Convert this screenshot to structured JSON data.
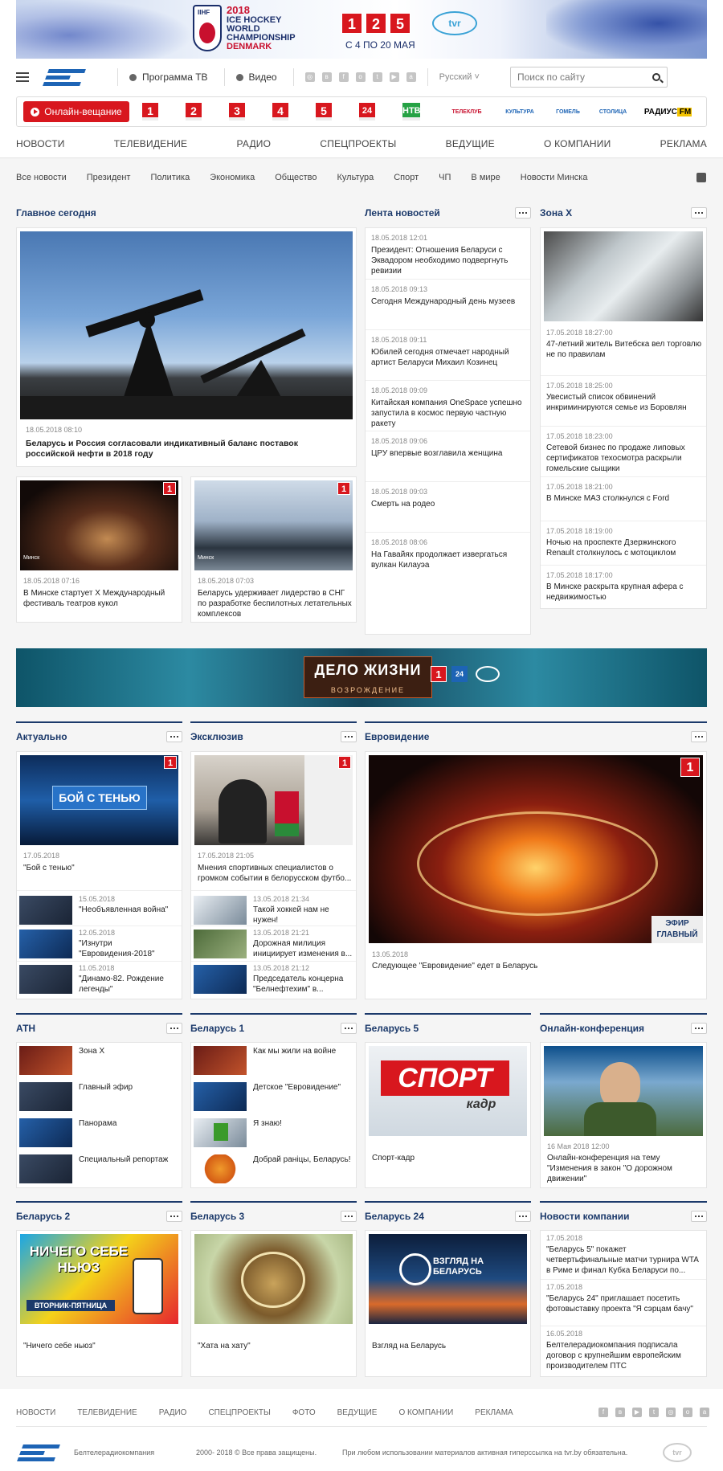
{
  "banner_top": {
    "year": "2018",
    "title_lines": [
      "ICE HOCKEY",
      "WORLD",
      "CHAMPIONSHIP"
    ],
    "country": "DENMARK",
    "brand": "IIHF",
    "channels": [
      "1",
      "2",
      "5"
    ],
    "tvr": "tvr",
    "dates": "С 4 ПО 20 МАЯ"
  },
  "header": {
    "program_label": "Программа ТВ",
    "video_label": "Видео",
    "language": "Русский",
    "search_placeholder": "Поиск по сайту",
    "socials": [
      "instagram-icon",
      "vk-icon",
      "facebook-icon",
      "ok-icon",
      "twitter-icon",
      "youtube-icon",
      "android-icon"
    ]
  },
  "channel_bar": {
    "online_label": "Онлайн-вещание",
    "channels": [
      "1",
      "2",
      "3",
      "4",
      "5",
      "24",
      "НТВ"
    ],
    "logos": [
      "ТЕЛЕКЛУБ",
      "КУЛЬТУРА",
      "ГОМЕЛЬ",
      "СТОЛИЦА",
      "РАДИУС FM"
    ]
  },
  "main_nav": [
    "НОВОСТИ",
    "ТЕЛЕВИДЕНИЕ",
    "РАДИО",
    "СПЕЦПРОЕКТЫ",
    "ВЕДУЩИЕ",
    "О КОМПАНИИ",
    "РЕКЛАМА"
  ],
  "sub_nav": [
    "Все новости",
    "Президент",
    "Политика",
    "Экономика",
    "Общество",
    "Культура",
    "Спорт",
    "ЧП",
    "В мире",
    "Новости Минска"
  ],
  "main_today": {
    "title": "Главное сегодня",
    "lead": {
      "date": "18.05.2018 08:10",
      "text": "Беларусь и Россия согласовали индикативный баланс поставок российской нефти в 2018 году"
    },
    "items": [
      {
        "date": "18.05.2018 07:16",
        "text": "В Минске стартует X Международный фестиваль театров кукол",
        "tag": "Минск"
      },
      {
        "date": "18.05.2018 07:03",
        "text": "Беларусь удерживает лидерство в СНГ по разработке беспилотных летательных комплексов",
        "tag": "Минск"
      }
    ]
  },
  "news_feed": {
    "title": "Лента новостей",
    "items": [
      {
        "date": "18.05.2018 12:01",
        "text": "Президент: Отношения Беларуси с Эквадором необходимо подвергнуть ревизии"
      },
      {
        "date": "18.05.2018 09:13",
        "text": "Сегодня Международный день музеев"
      },
      {
        "date": "18.05.2018 09:11",
        "text": "Юбилей сегодня отмечает народный артист Беларуси Михаил Козинец"
      },
      {
        "date": "18.05.2018 09:09",
        "text": "Китайская компания OneSpace успешно запустила в космос первую частную ракету"
      },
      {
        "date": "18.05.2018 09:06",
        "text": "ЦРУ впервые возглавила женщина"
      },
      {
        "date": "18.05.2018 09:03",
        "text": "Смерть на родео"
      },
      {
        "date": "18.05.2018 08:06",
        "text": "На Гавайях продолжает извергаться вулкан Килауэа"
      }
    ]
  },
  "zona_x": {
    "title": "Зона Х",
    "items": [
      {
        "date": "17.05.2018 18:27:00",
        "text": "47-летний житель Витебска вел торговлю не по правилам"
      },
      {
        "date": "17.05.2018 18:25:00",
        "text": "Увесистый список обвинений инкриминируются семье из Боровлян"
      },
      {
        "date": "17.05.2018 18:23:00",
        "text": "Сетевой бизнес по продаже липовых сертификатов техосмотра раскрыли гомельские сыщики"
      },
      {
        "date": "17.05.2018 18:21:00",
        "text": "В Минске МАЗ столкнулся с Ford"
      },
      {
        "date": "17.05.2018 18:19:00",
        "text": "Ночью на проспекте Дзержинского Renault столкнулось с мотоциклом"
      },
      {
        "date": "17.05.2018 18:17:00",
        "text": "В Минске раскрыта крупная афера с недвижимостью"
      }
    ]
  },
  "mid_banner": {
    "title": "ДЕЛО ЖИЗНИ",
    "subtitle": "ВОЗРОЖДЕНИЕ"
  },
  "aktualno": {
    "title": "Актуально",
    "lead_overlay": "БОЙ С ТЕНЬЮ",
    "lead": {
      "date": "17.05.2018",
      "text": "\"Бой с тенью\""
    },
    "items": [
      {
        "date": "15.05.2018",
        "text": "\"Необъявленная война\""
      },
      {
        "date": "12.05.2018",
        "text": "\"Изнутри \"Евровидения-2018\""
      },
      {
        "date": "11.05.2018",
        "text": "\"Динамо-82. Рождение легенды\""
      }
    ]
  },
  "exclusive": {
    "title": "Эксклюзив",
    "lead": {
      "date": "17.05.2018 21:05",
      "text": "Мнения спортивных специалистов о громком событии в белорусском футбо..."
    },
    "items": [
      {
        "date": "13.05.2018 21:34",
        "text": "Такой хоккей нам не нужен!"
      },
      {
        "date": "13.05.2018 21:21",
        "text": "Дорожная милиция инициирует изменения в..."
      },
      {
        "date": "13.05.2018 21:12",
        "text": "Председатель концерна \"Белнефтехим\" в..."
      }
    ]
  },
  "eurovision": {
    "title": "Евровидение",
    "overlay": "ЭФИР ГЛАВНЫЙ",
    "date": "13.05.2018",
    "text": "Следующее \"Евровидение\" едет в Беларусь"
  },
  "atn": {
    "title": "АТН",
    "items": [
      "Зона Х",
      "Главный эфир",
      "Панорама",
      "Специальный репортаж"
    ]
  },
  "belarus1": {
    "title": "Беларусь 1",
    "items": [
      "Как мы жили на войне",
      "Детское \"Евровидение\"",
      "Я знаю!",
      "Добрай раніцы, Беларусь!"
    ]
  },
  "belarus5": {
    "title": "Беларусь 5",
    "overlay": "СПОРТ",
    "overlay_sub": "кадр",
    "text": "Спорт-кадр"
  },
  "online_conf": {
    "title": "Онлайн-конференция",
    "date": "16 Мая 2018 12:00",
    "text": "Онлайн-конференция на тему \"Изменения в закон \"О дорожном движении\""
  },
  "belarus2": {
    "title": "Беларусь 2",
    "overlay": "НИЧЕГО СЕБЕ НЬЮЗ",
    "overlay_sub": "ВТОРНИК-ПЯТНИЦА",
    "text": "\"Ничего себе ньюз\""
  },
  "belarus3": {
    "title": "Беларусь 3",
    "text": "\"Хата на хату\""
  },
  "belarus24": {
    "title": "Беларусь 24",
    "overlay": "ВЗГЛЯД НА БЕЛАРУСЬ",
    "text": "Взгляд на Беларусь"
  },
  "company_news": {
    "title": "Новости компании",
    "items": [
      {
        "date": "17.05.2018",
        "text": "\"Беларусь 5\" покажет четвертьфинальные матчи турнира WTA в Риме и финал Кубка Беларуси по..."
      },
      {
        "date": "17.05.2018",
        "text": "\"Беларусь 24\" приглашает посетить фотовыставку проекта \"Я сэрцам бачу\""
      },
      {
        "date": "16.05.2018",
        "text": "Белтелерадиокомпания подписала договор с крупнейшим европейским производителем ПТС"
      }
    ]
  },
  "footer": {
    "nav": [
      "НОВОСТИ",
      "ТЕЛЕВИДЕНИЕ",
      "РАДИО",
      "СПЕЦПРОЕКТЫ",
      "ФОТО",
      "ВЕДУЩИЕ",
      "О КОМПАНИИ",
      "РЕКЛАМА"
    ],
    "company": "Белтелерадиокомпания",
    "copyright": "2000- 2018 © Все права защищены.",
    "notice": "При любом использовании материалов активная гиперссылка на tvr.by обязательна.",
    "tvr": "tvr"
  },
  "colors": {
    "accent_red": "#d8171e",
    "nav_blue": "#1c3a6b",
    "logo_blue": "#1d64b5"
  }
}
